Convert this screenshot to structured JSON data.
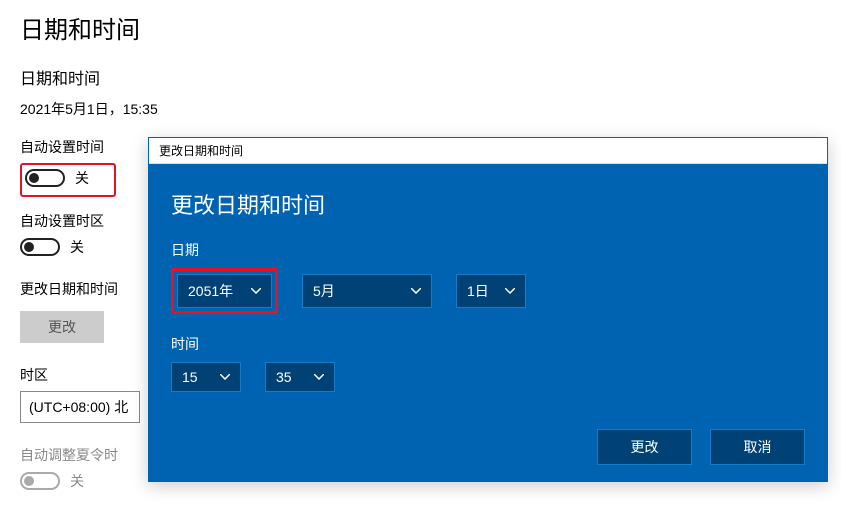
{
  "page": {
    "title": "日期和时间",
    "subtitle": "日期和时间",
    "current_datetime": "2021年5月1日，15:35",
    "auto_time_label": "自动设置时间",
    "auto_time_state": "关",
    "auto_tz_label": "自动设置时区",
    "auto_tz_state": "关",
    "change_dt_label": "更改日期和时间",
    "change_btn": "更改",
    "tz_label": "时区",
    "tz_value": "(UTC+08:00) 北",
    "dst_label": "自动调整夏令时",
    "dst_state": "关"
  },
  "dialog": {
    "titlebar": "更改日期和时间",
    "heading": "更改日期和时间",
    "date_label": "日期",
    "year": "2051年",
    "month": "5月",
    "day": "1日",
    "time_label": "时间",
    "hour": "15",
    "minute": "35",
    "change_btn": "更改",
    "cancel_btn": "取消"
  }
}
